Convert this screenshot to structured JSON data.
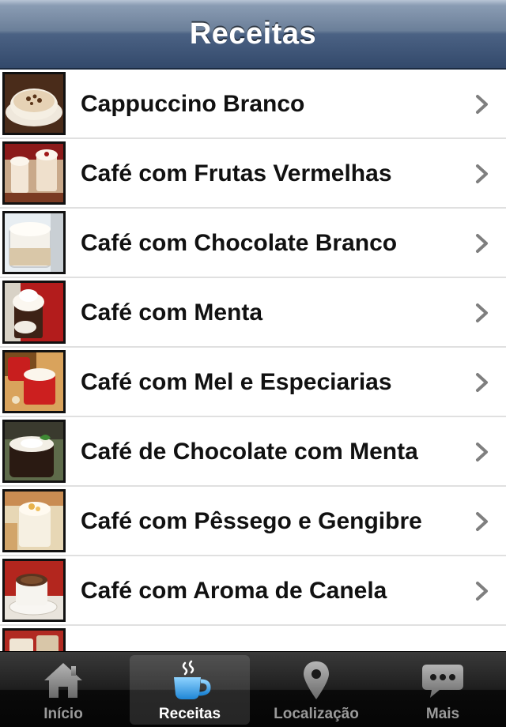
{
  "navbar": {
    "title": "Receitas"
  },
  "recipes": [
    {
      "label": "Cappuccino Branco"
    },
    {
      "label": "Café com Frutas Vermelhas"
    },
    {
      "label": "Café com Chocolate Branco"
    },
    {
      "label": "Café com Menta"
    },
    {
      "label": "Café com Mel e Especiarias"
    },
    {
      "label": "Café de Chocolate com Menta"
    },
    {
      "label": "Café com Pêssego e Gengibre"
    },
    {
      "label": "Café com Aroma de Canela"
    },
    {
      "label": ""
    }
  ],
  "tabbar": {
    "tabs": [
      {
        "label": "Início",
        "icon": "home-icon"
      },
      {
        "label": "Receitas",
        "icon": "coffee-cup-icon",
        "active": true
      },
      {
        "label": "Localização",
        "icon": "map-pin-icon"
      },
      {
        "label": "Mais",
        "icon": "chat-bubble-icon"
      }
    ]
  },
  "colors": {
    "navbar": "#4b6284",
    "tab_active_icon": "#3ea6e8",
    "tab_inactive": "#9a9a9a"
  }
}
